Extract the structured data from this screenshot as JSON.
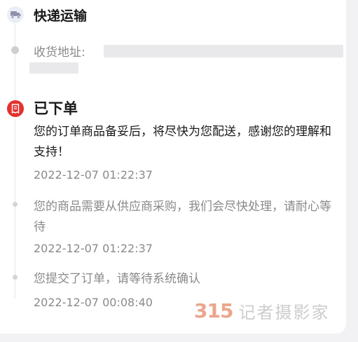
{
  "header": {
    "title": "快递运输",
    "icon": "truck-icon"
  },
  "address": {
    "label": "收货地址:"
  },
  "status": {
    "title": "已下单",
    "icon": "receipt-icon",
    "accent_color": "#e2332f"
  },
  "events": [
    {
      "text": "您的订单商品备妥后，将尽快为您配送，感谢您的理解和支持！",
      "time": "2022-12-07 01:22:37"
    },
    {
      "text": "您的商品需要从供应商采购，我们会尽快处理，请耐心等待",
      "time": "2022-12-07 01:22:37"
    },
    {
      "text": "您提交了订单，请等待系统确认",
      "time": "2022-12-07 00:08:40"
    }
  ],
  "watermark": {
    "number": "315",
    "text": "记者摄影家"
  }
}
